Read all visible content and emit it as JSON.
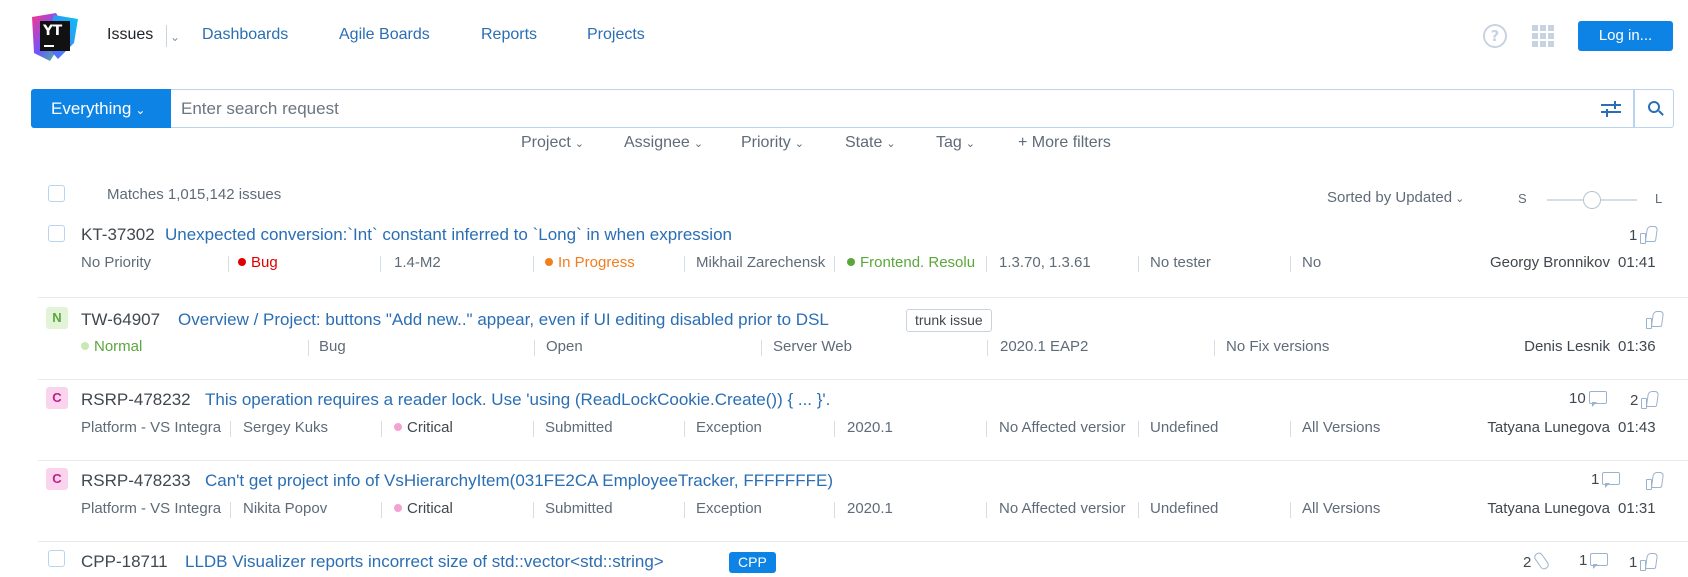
{
  "header": {
    "logo_text": "YT",
    "nav": {
      "issues": "Issues",
      "dashboards": "Dashboards",
      "agile_boards": "Agile Boards",
      "reports": "Reports",
      "projects": "Projects"
    },
    "login_label": "Log in..."
  },
  "search": {
    "scope_label": "Everything",
    "placeholder": "Enter search request"
  },
  "filters": {
    "project": "Project",
    "assignee": "Assignee",
    "priority": "Priority",
    "state": "State",
    "tag": "Tag",
    "more": "+ More filters"
  },
  "list": {
    "matches": "Matches 1,015,142 issues",
    "sorted": "Sorted by Updated",
    "size_small": "S",
    "size_large": "L",
    "size_level": 0.5
  },
  "colors": {
    "accent": "#0d84e5",
    "link": "#2a6eb4",
    "bug": "#e00000",
    "in_progress": "#f27e1d",
    "normal": "#5ba73b",
    "critical_dot": "#f4a1d4"
  },
  "issues": [
    {
      "id": "KT-37302",
      "summary": "Unexpected conversion:`Int` constant inferred to `Long` in when expression",
      "fields": [
        "No Priority",
        "Bug",
        "1.4-M2",
        "In Progress",
        "Mikhail Zarechensk",
        "Frontend. Resolu",
        "1.3.70, 1.3.61",
        "No tester",
        "No"
      ],
      "assignee": "Georgy Bronnikov",
      "time": "01:41",
      "votes": "1"
    },
    {
      "badge": "N",
      "id": "TW-64907",
      "summary": "Overview / Project: buttons \"Add new..\" appear, even if UI editing disabled prior to DSL",
      "tag": "trunk issue",
      "fields": [
        "Normal",
        "Bug",
        "Open",
        "Server Web",
        "2020.1 EAP2",
        "No Fix versions"
      ],
      "assignee": "Denis Lesnik",
      "time": "01:36"
    },
    {
      "badge": "C",
      "id": "RSRP-478232",
      "summary": "This operation requires a reader lock. Use 'using (ReadLockCookie.Create()) { ... }'.",
      "fields": [
        "Platform - VS Integra",
        "Sergey Kuks",
        "Critical",
        "Submitted",
        "Exception",
        "2020.1",
        "No Affected versior",
        "Undefined",
        "All Versions"
      ],
      "assignee": "Tatyana Lunegova",
      "time": "01:43",
      "comments": "10",
      "votes": "2"
    },
    {
      "badge": "C",
      "id": "RSRP-478233",
      "summary": "Can't get project info of VsHierarchyItem(031FE2CA EmployeeTracker, FFFFFFFE)",
      "fields": [
        "Platform - VS Integra",
        "Nikita Popov",
        "Critical",
        "Submitted",
        "Exception",
        "2020.1",
        "No Affected versior",
        "Undefined",
        "All Versions"
      ],
      "assignee": "Tatyana Lunegova",
      "time": "01:31",
      "comments": "1"
    },
    {
      "id": "CPP-18711",
      "summary": "LLDB Visualizer reports incorrect size of std::vector<std::string>",
      "tag": "CPP",
      "attachments": "2",
      "comments": "1",
      "votes": "1"
    }
  ]
}
